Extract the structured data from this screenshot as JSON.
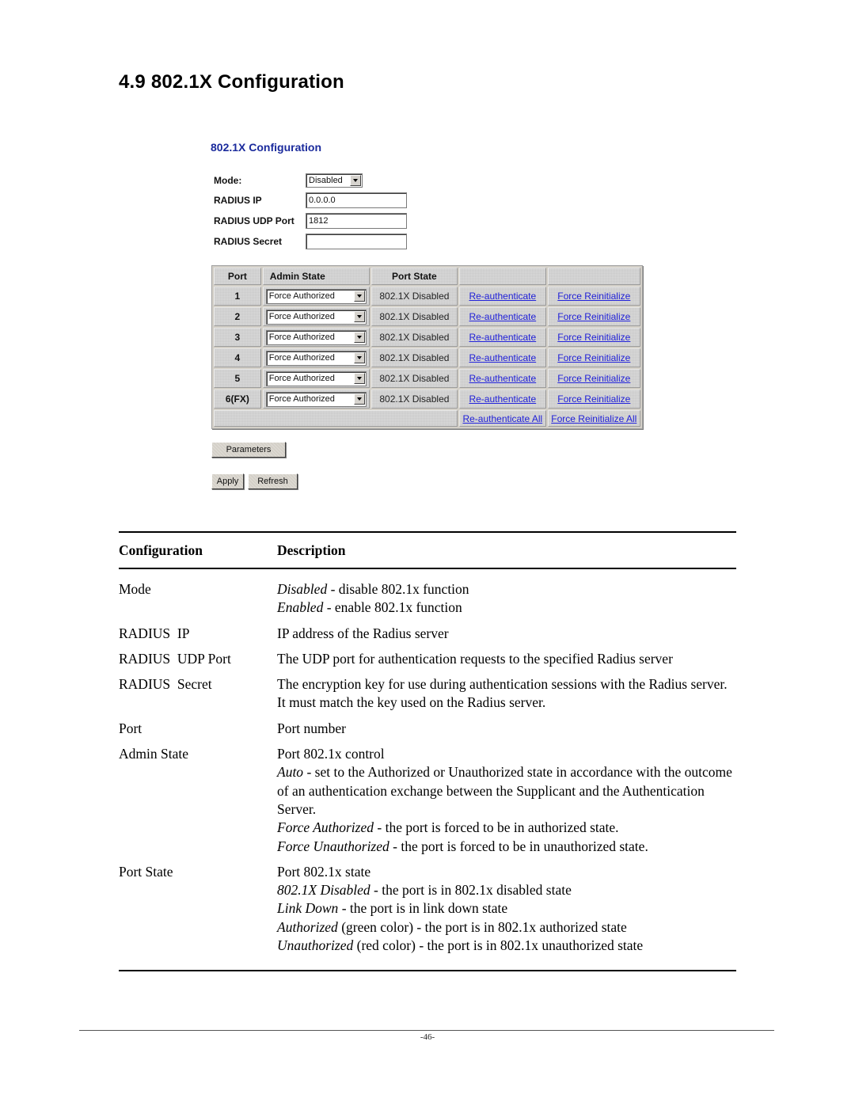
{
  "section_title": "4.9 802.1X Configuration",
  "ui": {
    "title": "802.1X Configuration",
    "form": {
      "mode_label": "Mode:",
      "mode_value": "Disabled",
      "radius_ip_label": "RADIUS IP",
      "radius_ip_value": "0.0.0.0",
      "radius_udp_port_label": "RADIUS UDP Port",
      "radius_udp_port_value": "1812",
      "radius_secret_label": "RADIUS Secret",
      "radius_secret_value": ""
    },
    "port_table": {
      "headers": {
        "port": "Port",
        "admin_state": "Admin State",
        "port_state": "Port State"
      },
      "rows": [
        {
          "port": "1",
          "admin_state": "Force Authorized",
          "port_state": "802.1X Disabled",
          "reauth": "Re-authenticate",
          "force": "Force Reinitialize"
        },
        {
          "port": "2",
          "admin_state": "Force Authorized",
          "port_state": "802.1X Disabled",
          "reauth": "Re-authenticate",
          "force": "Force Reinitialize"
        },
        {
          "port": "3",
          "admin_state": "Force Authorized",
          "port_state": "802.1X Disabled",
          "reauth": "Re-authenticate",
          "force": "Force Reinitialize"
        },
        {
          "port": "4",
          "admin_state": "Force Authorized",
          "port_state": "802.1X Disabled",
          "reauth": "Re-authenticate",
          "force": "Force Reinitialize"
        },
        {
          "port": "5",
          "admin_state": "Force Authorized",
          "port_state": "802.1X Disabled",
          "reauth": "Re-authenticate",
          "force": "Force Reinitialize"
        },
        {
          "port": "6(FX)",
          "admin_state": "Force Authorized",
          "port_state": "802.1X Disabled",
          "reauth": "Re-authenticate",
          "force": "Force Reinitialize"
        }
      ],
      "reauth_all": "Re-authenticate All",
      "force_all": "Force Reinitialize All"
    },
    "buttons": {
      "parameters": "Parameters",
      "apply": "Apply",
      "refresh": "Refresh"
    }
  },
  "description_table": {
    "headers": {
      "config": "Configuration",
      "description": "Description"
    },
    "rows": [
      {
        "config": "Mode",
        "lines": [
          {
            "em": "Disabled",
            "text": " - disable 802.1x function"
          },
          {
            "em": "Enabled",
            "text": " - enable 802.1x function"
          }
        ]
      },
      {
        "config": "RADIUS  IP",
        "lines": [
          {
            "em": "",
            "text": "IP address of the Radius server"
          }
        ]
      },
      {
        "config": "RADIUS  UDP Port",
        "lines": [
          {
            "em": "",
            "text": "The UDP port for authentication requests to the specified Radius server"
          }
        ]
      },
      {
        "config": "RADIUS  Secret",
        "lines": [
          {
            "em": "",
            "text": "The encryption key for use during authentication sessions with the Radius server. It must match the key used on the Radius server."
          }
        ]
      },
      {
        "config": "Port",
        "lines": [
          {
            "em": "",
            "text": "Port number"
          }
        ]
      },
      {
        "config": "Admin State",
        "lines": [
          {
            "em": "",
            "text": "Port 802.1x control"
          },
          {
            "em": "Auto",
            "text": " - set to the Authorized or Unauthorized state in accordance with the outcome of an authentication exchange between the Supplicant and the Authentication Server."
          },
          {
            "em": "Force Authorized",
            "text": " - the port is forced to be in authorized state."
          },
          {
            "em": "Force Unauthorized",
            "text": " - the port is forced to be in unauthorized state."
          }
        ]
      },
      {
        "config": "Port State",
        "lines": [
          {
            "em": "",
            "text": "Port 802.1x state"
          },
          {
            "em": "802.1X Disabled",
            "text": " - the port is in 802.1x disabled state"
          },
          {
            "em": "Link Down",
            "text": " - the port is in link down state"
          },
          {
            "em": "Authorized",
            "text": " (green color) - the port is in 802.1x authorized state"
          },
          {
            "em": "Unauthorized",
            "text": " (red color) - the port is in 802.1x unauthorized state"
          }
        ]
      }
    ]
  },
  "page_number": "-46-",
  "colors": {
    "ui_title": "#1a2a9c",
    "link": "#2020d8",
    "table_bg": "#c8c8c8"
  }
}
